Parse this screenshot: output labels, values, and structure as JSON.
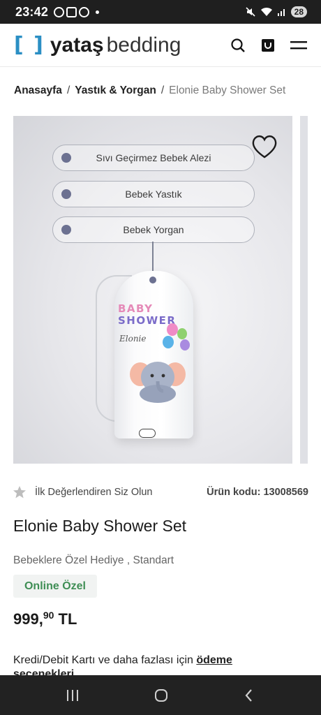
{
  "status_bar": {
    "time": "23:42",
    "battery": "28"
  },
  "header": {
    "logo_bracket": "[ ]",
    "logo_brand": "yataş",
    "logo_suffix": "bedding"
  },
  "breadcrumb": {
    "items": [
      "Anasayfa",
      "Yastık & Yorgan"
    ],
    "separator": "/",
    "current": "Elonie Baby Shower Set"
  },
  "product_image": {
    "labels": [
      "Sıvı Geçirmez Bebek Alezi",
      "Bebek Yastık",
      "Bebek Yorgan"
    ],
    "bag_text_line1": "BABY",
    "bag_text_line2": "SHOWER",
    "bag_text_script": "Elonie"
  },
  "rating": {
    "text": "İlk Değerlendiren Siz Olun",
    "code_label": "Ürün kodu:",
    "code_value": "13008569"
  },
  "product": {
    "title": "Elonie Baby Shower Set",
    "subtitle": "Bebeklere Özel Hediye , Standart",
    "badge": "Online Özel",
    "price_main": "999,",
    "price_cents": "90",
    "price_currency": "TL",
    "payment_prefix": "Kredi/Debit Kartı ve daha fazlası için",
    "payment_link_1": "ödeme",
    "payment_link_2": "seçenekleri"
  },
  "icons": {
    "search": "search-icon",
    "cart": "cart-icon",
    "menu": "menu-icon",
    "favorite": "heart-icon",
    "star": "star-icon"
  },
  "colors": {
    "brand_blue": "#2b8fc4",
    "online_green": "#3f8e55",
    "status_bar": "#1f1f1f",
    "nav_bar": "#222222"
  }
}
